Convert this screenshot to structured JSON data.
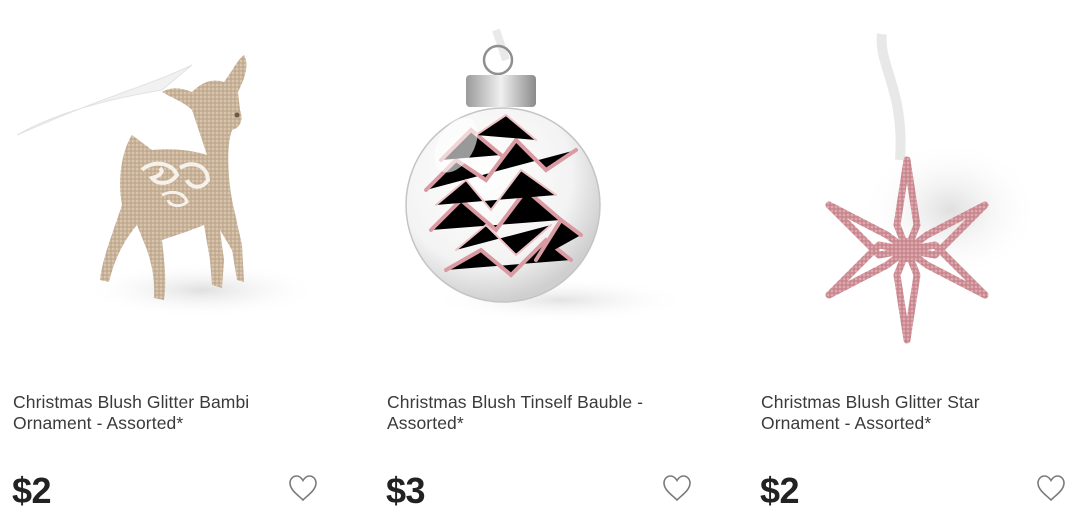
{
  "products": [
    {
      "title": "Christmas Blush Glitter Bambi Ornament - Assorted*",
      "price": "$2",
      "image_icon": "glitter-bambi-ornament-image",
      "wishlist_icon": "heart-outline-icon"
    },
    {
      "title": "Christmas Blush Tinself Bauble - Assorted*",
      "price": "$3",
      "image_icon": "tinsel-bauble-image",
      "wishlist_icon": "heart-outline-icon"
    },
    {
      "title": "Christmas Blush Glitter Star Ornament - Assorted*",
      "price": "$2",
      "image_icon": "glitter-star-ornament-image",
      "wishlist_icon": "heart-outline-icon"
    }
  ],
  "colors": {
    "glitter_gold": "#c9b49a",
    "blush_pink": "#d99aa1",
    "text": "#3a3a3a",
    "price": "#222222"
  }
}
